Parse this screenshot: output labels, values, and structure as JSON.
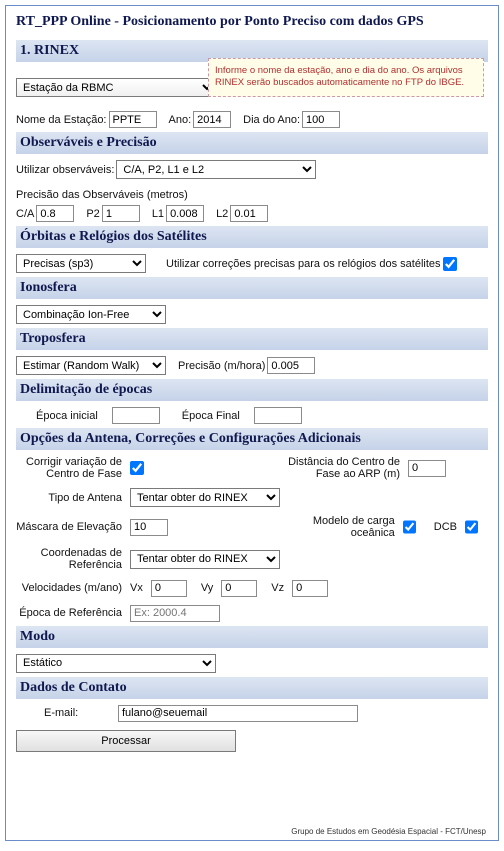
{
  "title": "RT_PPP Online - Posicionamento por Ponto Preciso com dados GPS",
  "rinex": {
    "header": "1. RINEX",
    "info_box": "Informe o nome da estação, ano e dia do ano. Os arquivos RINEX serão buscados automaticamente no FTP do IBGE.",
    "source_select": "Estação da RBMC",
    "nome_label": "Nome da Estação:",
    "nome_value": "PPTE",
    "ano_label": "Ano:",
    "ano_value": "2014",
    "dia_label": "Dia do Ano:",
    "dia_value": "100"
  },
  "obs": {
    "header": "Observáveis e Precisão",
    "utilizar_label": "Utilizar observáveis:",
    "utilizar_value": "C/A, P2, L1 e L2",
    "precisao_title": "Precisão das Observáveis (metros)",
    "ca_label": "C/A",
    "ca_value": "0.8",
    "p2_label": "P2",
    "p2_value": "1",
    "l1_label": "L1",
    "l1_value": "0.008",
    "l2_label": "L2",
    "l2_value": "0.01"
  },
  "orb": {
    "header": "Órbitas e Relógios dos Satélites",
    "select_value": "Precisas (sp3)",
    "clock_label": "Utilizar correções precisas para os relógios dos satélites"
  },
  "ion": {
    "header": "Ionosfera",
    "select_value": "Combinação Ion-Free"
  },
  "trop": {
    "header": "Troposfera",
    "select_value": "Estimar (Random Walk)",
    "prec_label": "Precisão (m/hora)",
    "prec_value": "0.005"
  },
  "epoch": {
    "header": "Delimitação de épocas",
    "inicial_label": "Época inicial",
    "inicial_value": "",
    "final_label": "Época Final",
    "final_value": ""
  },
  "ant": {
    "header": "Opções da Antena, Correções e Configurações Adicionais",
    "corr_label": "Corrigir variação de Centro de Fase",
    "dist_label": "Distância do Centro de Fase ao ARP (m)",
    "dist_value": "0",
    "tipo_label": "Tipo de Antena",
    "tipo_value": "Tentar obter do RINEX",
    "masc_label": "Máscara de Elevação",
    "masc_value": "10",
    "carga_label": "Modelo de carga oceânica",
    "dcb_label": "DCB",
    "coord_label": "Coordenadas de Referência",
    "coord_value": "Tentar obter do RINEX",
    "vel_label": "Velocidades (m/ano)",
    "vx_label": "Vx",
    "vx_value": "0",
    "vy_label": "Vy",
    "vy_value": "0",
    "vz_label": "Vz",
    "vz_value": "0",
    "epoca_ref_label": "Época de Referência",
    "epoca_ref_placeholder": "Ex: 2000.4"
  },
  "modo": {
    "header": "Modo",
    "select_value": "Estático"
  },
  "contato": {
    "header": "Dados de Contato",
    "email_label": "E-mail:",
    "email_value": "fulano@seuemail",
    "process_label": "Processar"
  },
  "footer": "Grupo de Estudos em Geodésia Espacial - FCT/Unesp"
}
